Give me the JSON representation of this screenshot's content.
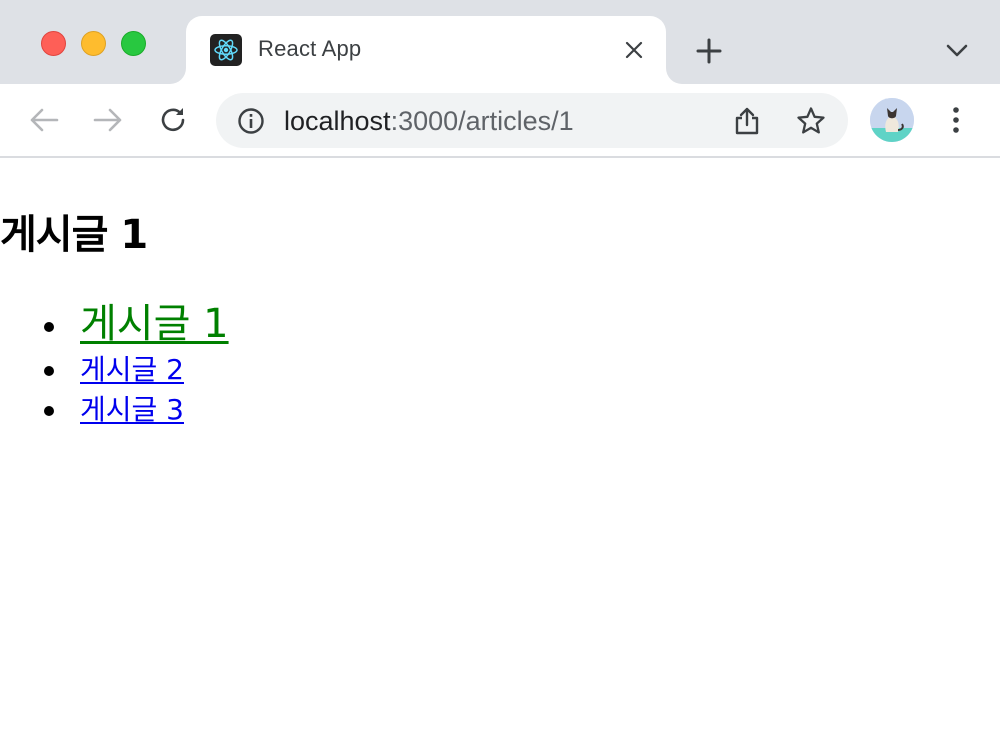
{
  "window": {
    "controls": [
      "close",
      "minimize",
      "zoom"
    ]
  },
  "tab": {
    "title": "React App",
    "favicon": "react-logo-icon",
    "close_icon": "close-icon"
  },
  "tabstrip": {
    "new_tab_icon": "plus-icon",
    "tab_search_icon": "chevron-down-icon"
  },
  "toolbar": {
    "back_icon": "arrow-left-icon",
    "forward_icon": "arrow-right-icon",
    "reload_icon": "reload-icon",
    "url_host": "localhost",
    "url_rest": ":3000/articles/1",
    "site_info_icon": "info-icon",
    "share_icon": "share-icon",
    "bookmark_icon": "star-icon",
    "profile_icon": "avatar",
    "menu_icon": "kebab-menu-icon"
  },
  "page": {
    "heading": "게시글 1",
    "articles": [
      {
        "label": "게시글 1",
        "active": true
      },
      {
        "label": "게시글 2",
        "active": false
      },
      {
        "label": "게시글 3",
        "active": false
      }
    ]
  },
  "colors": {
    "active_link": "#008000",
    "link": "#0000ee",
    "tabstrip_bg": "#dee1e6",
    "omnibox_bg": "#f1f3f4"
  }
}
